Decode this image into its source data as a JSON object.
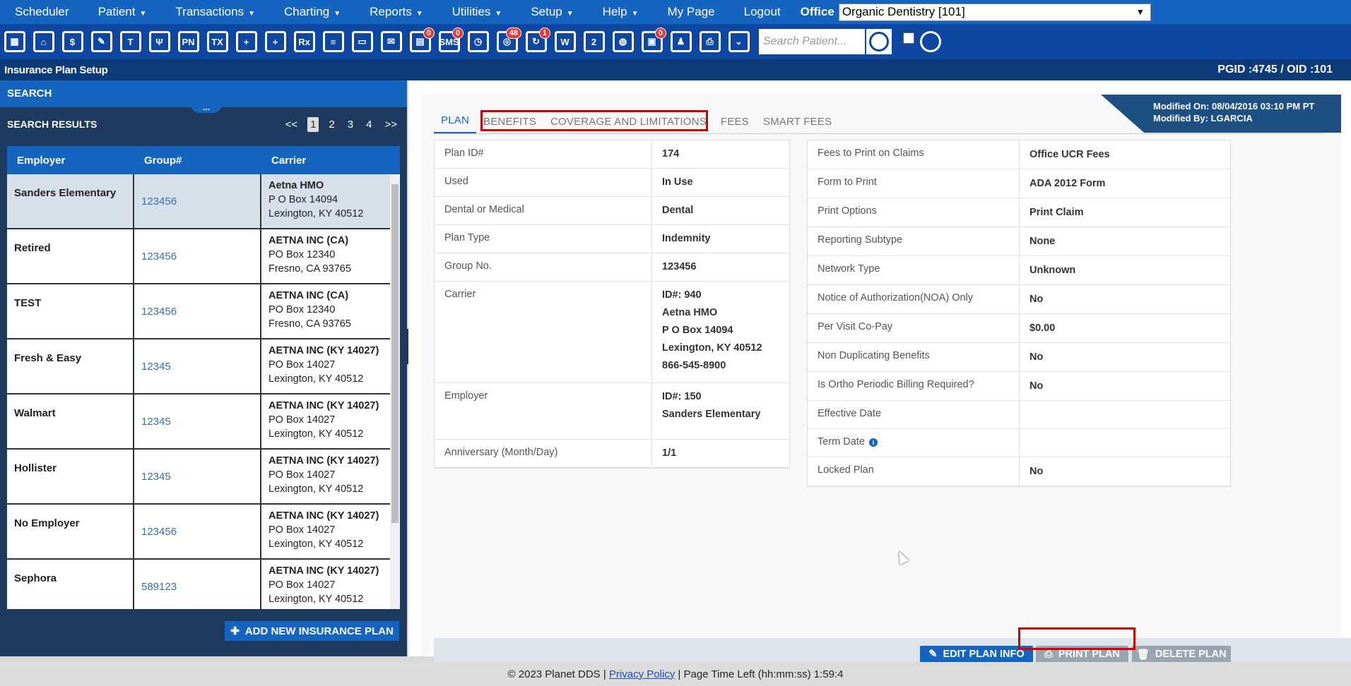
{
  "menu": {
    "items": [
      "Scheduler",
      "Patient",
      "Transactions",
      "Charting",
      "Reports",
      "Utilities",
      "Setup",
      "Help",
      "My Page",
      "Logout"
    ],
    "has_caret": [
      false,
      true,
      true,
      true,
      true,
      true,
      true,
      true,
      false,
      false
    ],
    "office_label": "Office",
    "office_value": "Organic Dentistry [101]"
  },
  "toolbar": {
    "icons": [
      {
        "name": "calendar-icon",
        "glyph": "▦"
      },
      {
        "name": "home-icon",
        "glyph": "⌂"
      },
      {
        "name": "dollar-icon",
        "glyph": "$"
      },
      {
        "name": "edit-note-icon",
        "glyph": "✎"
      },
      {
        "name": "tooth-icon",
        "glyph": "T"
      },
      {
        "name": "tooth-chart-icon",
        "glyph": "Ψ"
      },
      {
        "name": "pn-icon",
        "glyph": "PN"
      },
      {
        "name": "tx-icon",
        "glyph": "TX"
      },
      {
        "name": "add-user-icon",
        "glyph": "+"
      },
      {
        "name": "add-family-icon",
        "glyph": "+"
      },
      {
        "name": "rx-icon",
        "glyph": "Rx"
      },
      {
        "name": "notes-icon",
        "glyph": "≡"
      },
      {
        "name": "document-icon",
        "glyph": "▭"
      },
      {
        "name": "mail-icon",
        "glyph": "✉"
      },
      {
        "name": "messages-icon",
        "glyph": "▤",
        "badge": "0"
      },
      {
        "name": "sms-icon",
        "glyph": "SMS",
        "badge": "0"
      },
      {
        "name": "clock-icon",
        "glyph": "◷"
      },
      {
        "name": "online-users-icon",
        "glyph": "◎",
        "badge": "48"
      },
      {
        "name": "recall-icon",
        "glyph": "↻",
        "badge": "1"
      },
      {
        "name": "perio-icon",
        "glyph": "W"
      },
      {
        "name": "question-icon",
        "glyph": "2"
      },
      {
        "name": "web-icon",
        "glyph": "◍"
      },
      {
        "name": "forms-icon",
        "glyph": "▣",
        "badge": "0"
      },
      {
        "name": "group-icon",
        "glyph": "♟"
      },
      {
        "name": "printer-icon",
        "glyph": "⎙"
      },
      {
        "name": "collapse-down-icon",
        "glyph": "⌄"
      }
    ],
    "search_placeholder": "Search Patient..."
  },
  "title": {
    "page": "Insurance Plan Setup",
    "ids": "PGID :4745  /  OID :101"
  },
  "search": {
    "header": "SEARCH",
    "results_title": "SEARCH RESULTS",
    "pager": [
      "<<",
      "1",
      "2",
      "3",
      "4",
      ">>"
    ],
    "columns": [
      "Employer",
      "Group#",
      "Carrier"
    ],
    "rows": [
      {
        "employer": "Sanders Elementary",
        "group": "123456",
        "carrier": "Aetna HMO",
        "addr1": "P O Box 14094",
        "addr2": "Lexington, KY 40512"
      },
      {
        "employer": "Retired",
        "group": "123456",
        "carrier": "AETNA INC (CA)",
        "addr1": "PO Box 12340",
        "addr2": "Fresno, CA 93765"
      },
      {
        "employer": "TEST",
        "group": "123456",
        "carrier": "AETNA INC (CA)",
        "addr1": "PO Box 12340",
        "addr2": "Fresno, CA 93765"
      },
      {
        "employer": "Fresh & Easy",
        "group": "12345",
        "carrier": "AETNA INC (KY 14027)",
        "addr1": "PO Box 14027",
        "addr2": "Lexington, KY 40512"
      },
      {
        "employer": "Walmart",
        "group": "12345",
        "carrier": "AETNA INC (KY 14027)",
        "addr1": "PO Box 14027",
        "addr2": "Lexington, KY 40512"
      },
      {
        "employer": "Hollister",
        "group": "12345",
        "carrier": "AETNA INC (KY 14027)",
        "addr1": "PO Box 14027",
        "addr2": "Lexington, KY 40512"
      },
      {
        "employer": "No Employer",
        "group": "123456",
        "carrier": "AETNA INC (KY 14027)",
        "addr1": "PO Box 14027",
        "addr2": "Lexington, KY 40512"
      },
      {
        "employer": "Sephora",
        "group": "589123",
        "carrier": "AETNA INC (KY 14027)",
        "addr1": "PO Box 14027",
        "addr2": "Lexington, KY 40512"
      }
    ],
    "add_button": "ADD NEW INSURANCE PLAN"
  },
  "plan": {
    "modified_on": "Modified On: 08/04/2016 03:10 PM PT",
    "modified_by": "Modified By: LGARCIA",
    "tabs": [
      "PLAN",
      "BENEFITS",
      "COVERAGE AND LIMITATIONS",
      "FEES",
      "SMART FEES"
    ],
    "left_fields": [
      {
        "label": "Plan ID#",
        "value": [
          "174"
        ]
      },
      {
        "label": "Used",
        "value": [
          "In Use"
        ]
      },
      {
        "label": "Dental or Medical",
        "value": [
          "Dental"
        ]
      },
      {
        "label": "Plan Type",
        "value": [
          "Indemnity"
        ]
      },
      {
        "label": "Group No.",
        "value": [
          "123456"
        ]
      },
      {
        "label": "Carrier",
        "value": [
          "ID#: 940",
          "Aetna HMO",
          "P O Box 14094",
          "Lexington, KY 40512",
          "866-545-8900"
        ]
      },
      {
        "label": "Employer",
        "value": [
          "ID#: 150",
          "Sanders Elementary"
        ]
      },
      {
        "label": "Anniversary (Month/Day)",
        "value": [
          "1/1"
        ]
      }
    ],
    "right_fields": [
      {
        "label": "Fees to Print on Claims",
        "value": "Office UCR Fees"
      },
      {
        "label": "Form to Print",
        "value": "ADA 2012 Form"
      },
      {
        "label": "Print Options",
        "value": "Print Claim"
      },
      {
        "label": "Reporting Subtype",
        "value": "None"
      },
      {
        "label": "Network Type",
        "value": "Unknown"
      },
      {
        "label": "Notice of Authorization(NOA) Only",
        "value": "No"
      },
      {
        "label": "Per Visit Co-Pay",
        "value": "$0.00"
      },
      {
        "label": "Non Duplicating Benefits",
        "value": "No"
      },
      {
        "label": "Is Ortho Periodic Billing Required?",
        "value": "No"
      },
      {
        "label": "Effective Date",
        "value": ""
      },
      {
        "label": "Term Date",
        "value": "",
        "info": "i"
      },
      {
        "label": "Locked Plan",
        "value": "No"
      }
    ],
    "buttons": {
      "edit": "EDIT PLAN INFO",
      "print": "PRINT PLAN",
      "delete": "DELETE PLAN"
    }
  },
  "status": {
    "copyright": "© 2023 Planet DDS |",
    "privacy": "Privacy Policy",
    "time_left": "|  Page Time Left (hh:mm:ss) 1:59:4"
  }
}
